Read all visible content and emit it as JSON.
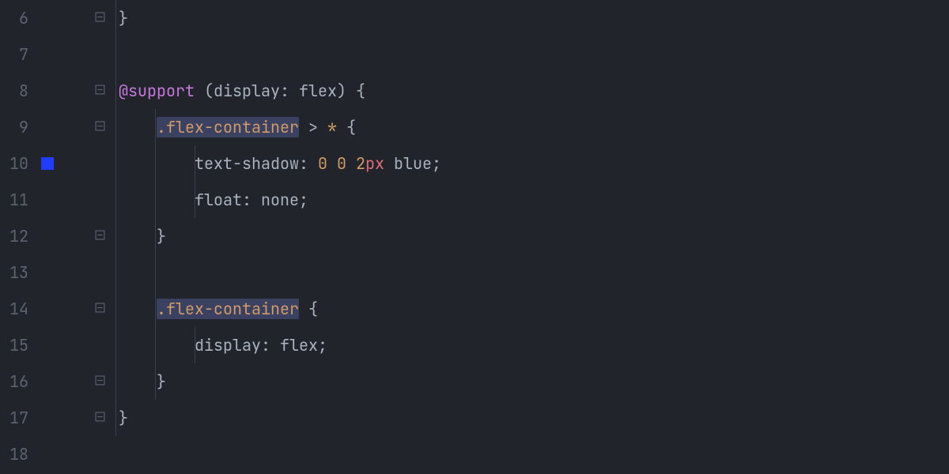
{
  "editor": {
    "gutter_marker_color": "#1f3cff",
    "lines": [
      {
        "num": "6",
        "fold": "close",
        "marker": false,
        "guides": [
          0
        ],
        "tokens": [
          {
            "t": "}",
            "c": "c-brace"
          }
        ]
      },
      {
        "num": "7",
        "fold": "",
        "marker": false,
        "guides": [
          0
        ],
        "tokens": []
      },
      {
        "num": "8",
        "fold": "open",
        "marker": false,
        "guides": [
          0
        ],
        "tokens": [
          {
            "t": "@support ",
            "c": "c-keyword"
          },
          {
            "t": "(",
            "c": "c-paren"
          },
          {
            "t": "display",
            "c": "c-propname"
          },
          {
            "t": ":",
            "c": "c-colon"
          },
          {
            "t": " flex",
            "c": "c-value"
          },
          {
            "t": ")",
            "c": "c-paren"
          },
          {
            "t": " {",
            "c": "c-brace"
          }
        ]
      },
      {
        "num": "9",
        "fold": "open",
        "marker": false,
        "guides": [
          0,
          1
        ],
        "tokens": [
          {
            "t": "    ",
            "c": ""
          },
          {
            "t": ".flex-container",
            "c": "c-selector-hl"
          },
          {
            "t": " > ",
            "c": "c-op"
          },
          {
            "t": "*",
            "c": "c-star"
          },
          {
            "t": " {",
            "c": "c-brace"
          }
        ]
      },
      {
        "num": "10",
        "fold": "",
        "marker": true,
        "guides": [
          0,
          1,
          2
        ],
        "tokens": [
          {
            "t": "        ",
            "c": ""
          },
          {
            "t": "text-shadow",
            "c": "c-propname"
          },
          {
            "t": ":",
            "c": "c-colon"
          },
          {
            "t": " ",
            "c": ""
          },
          {
            "t": "0",
            "c": "c-number"
          },
          {
            "t": " ",
            "c": ""
          },
          {
            "t": "0",
            "c": "c-number"
          },
          {
            "t": " ",
            "c": ""
          },
          {
            "t": "2",
            "c": "c-number"
          },
          {
            "t": "px",
            "c": "c-unit"
          },
          {
            "t": " blue",
            "c": "c-value"
          },
          {
            "t": ";",
            "c": "c-semi"
          }
        ]
      },
      {
        "num": "11",
        "fold": "",
        "marker": false,
        "guides": [
          0,
          1,
          2
        ],
        "tokens": [
          {
            "t": "        ",
            "c": ""
          },
          {
            "t": "float",
            "c": "c-propname"
          },
          {
            "t": ":",
            "c": "c-colon"
          },
          {
            "t": " none",
            "c": "c-value"
          },
          {
            "t": ";",
            "c": "c-semi"
          }
        ]
      },
      {
        "num": "12",
        "fold": "close",
        "marker": false,
        "guides": [
          0,
          1
        ],
        "tokens": [
          {
            "t": "    ",
            "c": ""
          },
          {
            "t": "}",
            "c": "c-brace"
          }
        ]
      },
      {
        "num": "13",
        "fold": "",
        "marker": false,
        "guides": [
          0,
          1
        ],
        "tokens": []
      },
      {
        "num": "14",
        "fold": "open",
        "marker": false,
        "guides": [
          0,
          1
        ],
        "tokens": [
          {
            "t": "    ",
            "c": ""
          },
          {
            "t": ".flex-container",
            "c": "c-selector-hl"
          },
          {
            "t": " {",
            "c": "c-brace"
          }
        ]
      },
      {
        "num": "15",
        "fold": "",
        "marker": false,
        "guides": [
          0,
          1,
          2
        ],
        "tokens": [
          {
            "t": "        ",
            "c": ""
          },
          {
            "t": "display",
            "c": "c-propname"
          },
          {
            "t": ":",
            "c": "c-colon"
          },
          {
            "t": " flex",
            "c": "c-value"
          },
          {
            "t": ";",
            "c": "c-semi"
          }
        ]
      },
      {
        "num": "16",
        "fold": "close",
        "marker": false,
        "guides": [
          0,
          1
        ],
        "tokens": [
          {
            "t": "    ",
            "c": ""
          },
          {
            "t": "}",
            "c": "c-brace"
          }
        ]
      },
      {
        "num": "17",
        "fold": "close",
        "marker": false,
        "guides": [
          0
        ],
        "tokens": [
          {
            "t": "}",
            "c": "c-brace"
          }
        ]
      },
      {
        "num": "18",
        "fold": "",
        "marker": false,
        "guides": [],
        "tokens": []
      }
    ]
  }
}
